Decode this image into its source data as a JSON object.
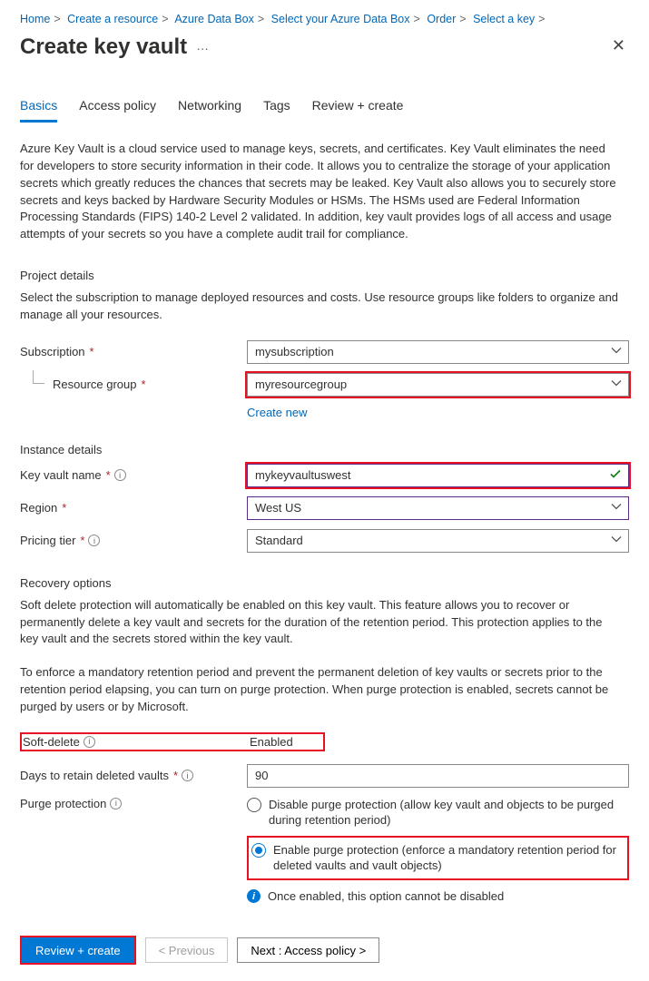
{
  "breadcrumb": {
    "items": [
      "Home",
      "Create a resource",
      "Azure Data Box",
      "Select your Azure Data Box",
      "Order",
      "Select a key"
    ]
  },
  "header": {
    "title": "Create key vault"
  },
  "tabs": {
    "items": [
      "Basics",
      "Access policy",
      "Networking",
      "Tags",
      "Review + create"
    ],
    "active": 0
  },
  "intro": "Azure Key Vault is a cloud service used to manage keys, secrets, and certificates. Key Vault eliminates the need for developers to store security information in their code. It allows you to centralize the storage of your application secrets which greatly reduces the chances that secrets may be leaked. Key Vault also allows you to securely store secrets and keys backed by Hardware Security Modules or HSMs. The HSMs used are Federal Information Processing Standards (FIPS) 140-2 Level 2 validated. In addition, key vault provides logs of all access and usage attempts of your secrets so you have a complete audit trail for compliance.",
  "project": {
    "heading": "Project details",
    "sub": "Select the subscription to manage deployed resources and costs. Use resource groups like folders to organize and manage all your resources.",
    "subscription_label": "Subscription",
    "subscription_value": "mysubscription",
    "rg_label": "Resource group",
    "rg_value": "myresourcegroup",
    "create_new": "Create new"
  },
  "instance": {
    "heading": "Instance details",
    "name_label": "Key vault name",
    "name_value": "mykeyvaultuswest",
    "region_label": "Region",
    "region_value": "West US",
    "tier_label": "Pricing tier",
    "tier_value": "Standard"
  },
  "recovery": {
    "heading": "Recovery options",
    "sub1": "Soft delete protection will automatically be enabled on this key vault. This feature allows you to recover or permanently delete a key vault and secrets for the duration of the retention period. This protection applies to the key vault and the secrets stored within the key vault.",
    "sub2": "To enforce a mandatory retention period and prevent the permanent deletion of key vaults or secrets prior to the retention period elapsing, you can turn on purge protection. When purge protection is enabled, secrets cannot be purged by users or by Microsoft.",
    "soft_delete_label": "Soft-delete",
    "soft_delete_value": "Enabled",
    "retain_label": "Days to retain deleted vaults",
    "retain_value": "90",
    "purge_label": "Purge protection",
    "purge_opt1": "Disable purge protection (allow key vault and objects to be purged during retention period)",
    "purge_opt2": "Enable purge protection (enforce a mandatory retention period for deleted vaults and vault objects)",
    "note": "Once enabled, this option cannot be disabled"
  },
  "footer": {
    "review": "Review + create",
    "prev": "< Previous",
    "next": "Next : Access policy >"
  }
}
